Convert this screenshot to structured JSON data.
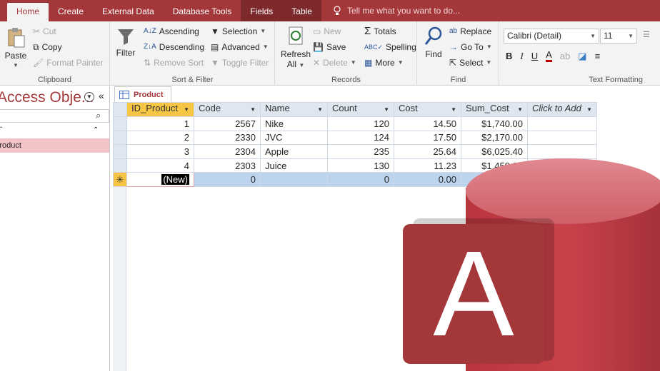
{
  "tabs": [
    "Home",
    "Create",
    "External Data",
    "Database Tools",
    "Fields",
    "Table"
  ],
  "tell_me": "Tell me what you want to do...",
  "clipboard": {
    "paste": "Paste",
    "cut": "Cut",
    "copy": "Copy",
    "format_painter": "Format Painter",
    "label": "Clipboard"
  },
  "sort_filter": {
    "filter": "Filter",
    "ascending": "Ascending",
    "descending": "Descending",
    "remove_sort": "Remove Sort",
    "selection": "Selection",
    "advanced": "Advanced",
    "toggle_filter": "Toggle Filter",
    "label": "Sort & Filter"
  },
  "records": {
    "refresh": "Refresh",
    "refresh2": "All",
    "new": "New",
    "save": "Save",
    "delete": "Delete",
    "totals": "Totals",
    "spelling": "Spelling",
    "more": "More",
    "label": "Records"
  },
  "find": {
    "find": "Find",
    "replace": "Replace",
    "goto": "Go To",
    "select": "Select",
    "label": "Find"
  },
  "text_formatting": {
    "font": "Calibri (Detail)",
    "size": "11",
    "label": "Text Formatting"
  },
  "sidebar": {
    "title": "Access Obje...",
    "section": "«",
    "item": "Product"
  },
  "document": {
    "tab": "Product"
  },
  "table": {
    "headers": [
      "ID_Product",
      "Code",
      "Name",
      "Count",
      "Cost",
      "Sum_Cost",
      "Click to Add"
    ],
    "rows": [
      [
        "1",
        "2567",
        "Nike",
        "120",
        "14.50",
        "$1,740.00"
      ],
      [
        "2",
        "2330",
        "JVC",
        "124",
        "17.50",
        "$2,170.00"
      ],
      [
        "3",
        "2304",
        "Apple",
        "235",
        "25.64",
        "$6,025.40"
      ],
      [
        "4",
        "2303",
        "Juice",
        "130",
        "11.23",
        "$1,459.90"
      ]
    ],
    "new_row": [
      "(New)",
      "0",
      "",
      "0",
      "0.00",
      ""
    ]
  },
  "logo": {
    "letter": "A",
    "colors": {
      "front": "#a4373a",
      "cylinder": "#c9424a"
    }
  }
}
